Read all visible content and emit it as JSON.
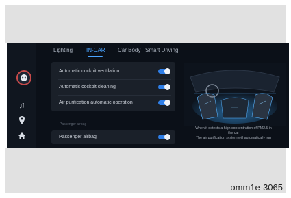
{
  "tabs": [
    {
      "label": "Lighting",
      "active": false
    },
    {
      "label": "IN-CAR",
      "active": true
    },
    {
      "label": "Car Body",
      "active": false
    },
    {
      "label": "Smart Driving",
      "active": false
    }
  ],
  "settings": [
    {
      "label": "Automatic cockpit ventilation",
      "enabled": true
    },
    {
      "label": "Automatic cockpit cleaning",
      "enabled": true
    },
    {
      "label": "Air purification automatic operation",
      "enabled": true
    }
  ],
  "airbag_section": {
    "title": "Passenger airbag",
    "item": {
      "label": "Passenger airbag",
      "enabled": true
    }
  },
  "hint_text": {
    "line1": "When it detects a high concentration of PM2.5 in",
    "line2": "the car",
    "line3": "The air purification system will automatically run"
  },
  "sidebar_icons": [
    "assistant-avatar-icon",
    "music-icon",
    "location-icon",
    "home-icon"
  ],
  "colors": {
    "accent": "#4aa3ff",
    "toggle_on": "#2f7fe8",
    "alert_ring": "#c84a4a"
  },
  "caption": "omm1e-3065"
}
